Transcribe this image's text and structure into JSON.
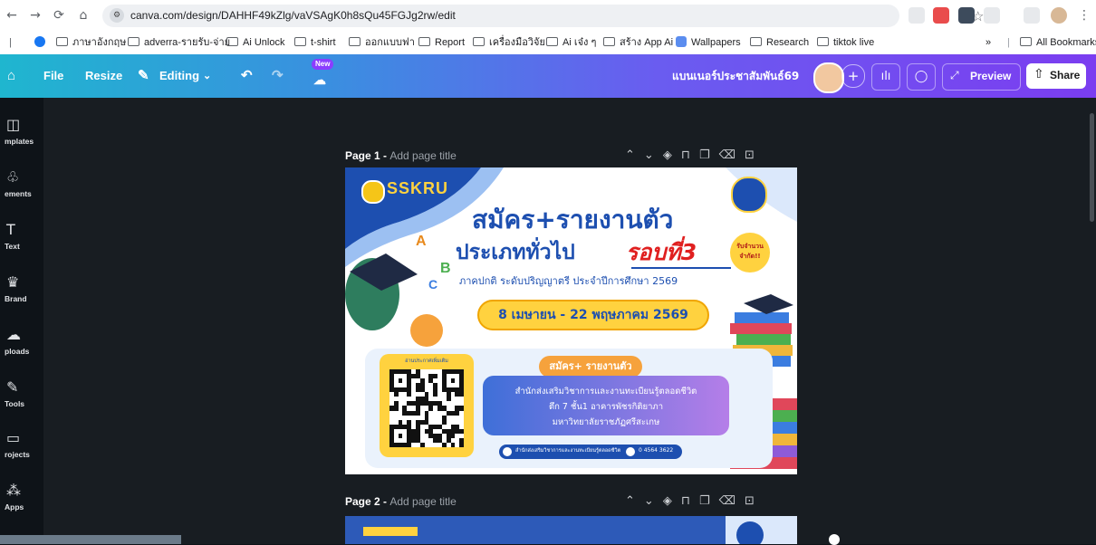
{
  "browser": {
    "url": "canva.com/design/DAHHF49kZlg/vaVSAgK0h8sQu45FGJg2rw/edit",
    "bookmarks": [
      "ภาษาอังกฤษ",
      "adverra-รายรับ-จ่าย",
      "Ai Unlock",
      "t-shirt",
      "ออกแบบฟา",
      "Report",
      "เครื่องมือวิจัย",
      "Ai เจ๋ง ๆ",
      "สร้าง App Ai",
      "Wallpapers",
      "Research",
      "tiktok live"
    ],
    "overflow": "»",
    "all_bookmarks": "All Bookmarks"
  },
  "toolbar": {
    "file": "File",
    "resize": "Resize",
    "editing": "Editing",
    "new_badge": "New",
    "doc_title": "แบนเนอร์ประชาสัมพันธ์69",
    "preview": "Preview",
    "share": "Share"
  },
  "sidebar": {
    "items": [
      {
        "label": "mplates",
        "icon": "layout-icon"
      },
      {
        "label": "ements",
        "icon": "elements-icon"
      },
      {
        "label": "Text",
        "icon": "text-icon"
      },
      {
        "label": "Brand",
        "icon": "brand-icon"
      },
      {
        "label": "ploads",
        "icon": "uploads-icon"
      },
      {
        "label": "Tools",
        "icon": "tools-icon"
      },
      {
        "label": "rojects",
        "icon": "folder-icon"
      },
      {
        "label": "Apps",
        "icon": "apps-icon"
      }
    ]
  },
  "pages": [
    {
      "title": "Page 1 - ",
      "add": "Add page title"
    },
    {
      "title": "Page 2 - ",
      "add": "Add page title"
    }
  ],
  "poster": {
    "logo": "SSKRU",
    "headline1": "สมัคร+รายงานตัว",
    "headline2a": "ประเภททั่วไป",
    "headline2b": "รอบที่3",
    "badge_right": "รับจำนวน จำกัด!!",
    "subtitle": "ภาคปกติ ระดับปริญญาตรี ประจำปีการศึกษา 2569",
    "dates": "8 เมษายน - 22 พฤษภาคม 2569",
    "qr_caption": "อ่านประกาศเพิ่มเติม",
    "section_title": "สมัคร+ รายงานตัว",
    "office1": "สำนักส่งเสริมวิชาการและงานทะเบียนรู้ตลอดชีวิต",
    "office2": "ตึก 7 ชั้น1 อาคารพัชรกิติยาภา",
    "office3": "มหาวิทยาลัยราชภัฏศรีสะเกษ",
    "footer_fb": "สำนักส่งเสริมวิชาการและงานทะเบียนรู้ตลอดชีวิต",
    "footer_phone": "0 4564 3622"
  },
  "colors": {
    "accent": "#8b3dff",
    "poster_blue": "#1d4fb0",
    "poster_red": "#e02020",
    "poster_yellow": "#ffd23f"
  }
}
